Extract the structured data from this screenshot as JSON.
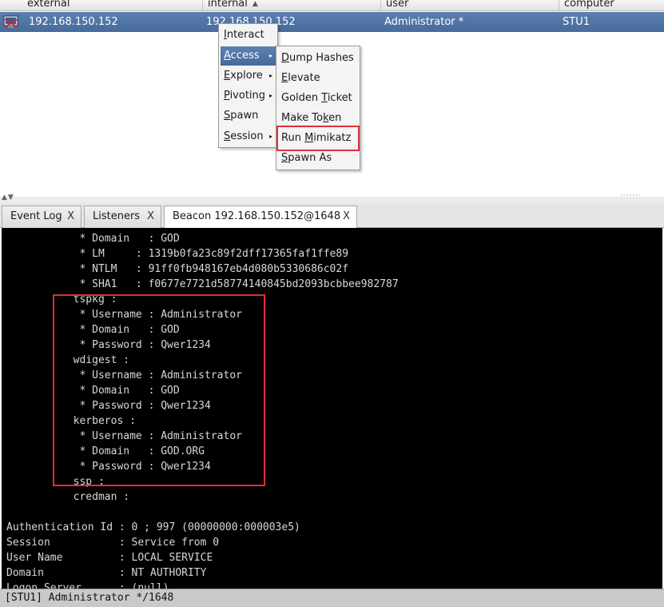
{
  "table": {
    "columns": [
      {
        "label": "external"
      },
      {
        "label": "internal",
        "sort": "▲"
      },
      {
        "label": "user"
      },
      {
        "label": "computer"
      }
    ],
    "selected_row": {
      "external": "192.168.150.152",
      "internal": "192.168.150.152",
      "user": "Administrator *",
      "computer": "STU1"
    }
  },
  "context_menu": {
    "items": [
      {
        "label": "Interact",
        "mnemonic": "I",
        "rest": "nteract"
      },
      {
        "label": "Access",
        "mnemonic": "A",
        "rest": "ccess"
      },
      {
        "label": "Explore",
        "mnemonic": "E",
        "rest": "xplore"
      },
      {
        "label": "Pivoting",
        "mnemonic": "P",
        "rest": "ivoting"
      },
      {
        "label": "Spawn",
        "mnemonic": "S",
        "rest": "pawn"
      },
      {
        "label": "Session",
        "mnemonic": "S",
        "rest": "ession"
      }
    ],
    "submenu_arrow": "▸"
  },
  "access_submenu": {
    "items": [
      {
        "pre": "",
        "mnemonic": "D",
        "post": "ump Hashes"
      },
      {
        "pre": "",
        "mnemonic": "E",
        "post": "levate"
      },
      {
        "pre": "Golden ",
        "mnemonic": "T",
        "post": "icket"
      },
      {
        "pre": "Make To",
        "mnemonic": "k",
        "post": "en"
      },
      {
        "pre": "Run ",
        "mnemonic": "M",
        "post": "imikatz"
      },
      {
        "pre": "",
        "mnemonic": "S",
        "post": "pawn As"
      }
    ]
  },
  "tabs": [
    {
      "label": "Event Log",
      "close": "X"
    },
    {
      "label": "Listeners",
      "close": "X"
    },
    {
      "label": "Beacon 192.168.150.152@1648",
      "close": "X"
    }
  ],
  "console": {
    "lines": [
      "   * Domain   : GOD",
      "   * LM     : 1319b0fa23c89f2dff17365faf1ffe89",
      "   * NTLM   : 91ff0fb948167eb4d080b5330686c02f",
      "   * SHA1   : f0677e7721d58774140845bd2093bcbbee982787",
      "  tspkg :",
      "   * Username : Administrator",
      "   * Domain   : GOD",
      "   * Password : Qwer1234",
      "  wdigest :",
      "   * Username : Administrator",
      "   * Domain   : GOD",
      "   * Password : Qwer1234",
      "  kerberos :",
      "   * Username : Administrator",
      "   * Domain   : GOD.ORG",
      "   * Password : Qwer1234",
      "  ssp :",
      "  credman :",
      "",
      "Authentication Id : 0 ; 997 (00000000:000003e5)",
      "Session           : Service from 0",
      "User Name         : LOCAL SERVICE",
      "Domain            : NT AUTHORITY",
      "Logon Server      : (null)"
    ]
  },
  "status_bar": "[STU1] Administrator */1648",
  "colors": {
    "selection": "#4a6fa0",
    "highlight_box": "#e0303a",
    "console_bg": "#000000"
  }
}
